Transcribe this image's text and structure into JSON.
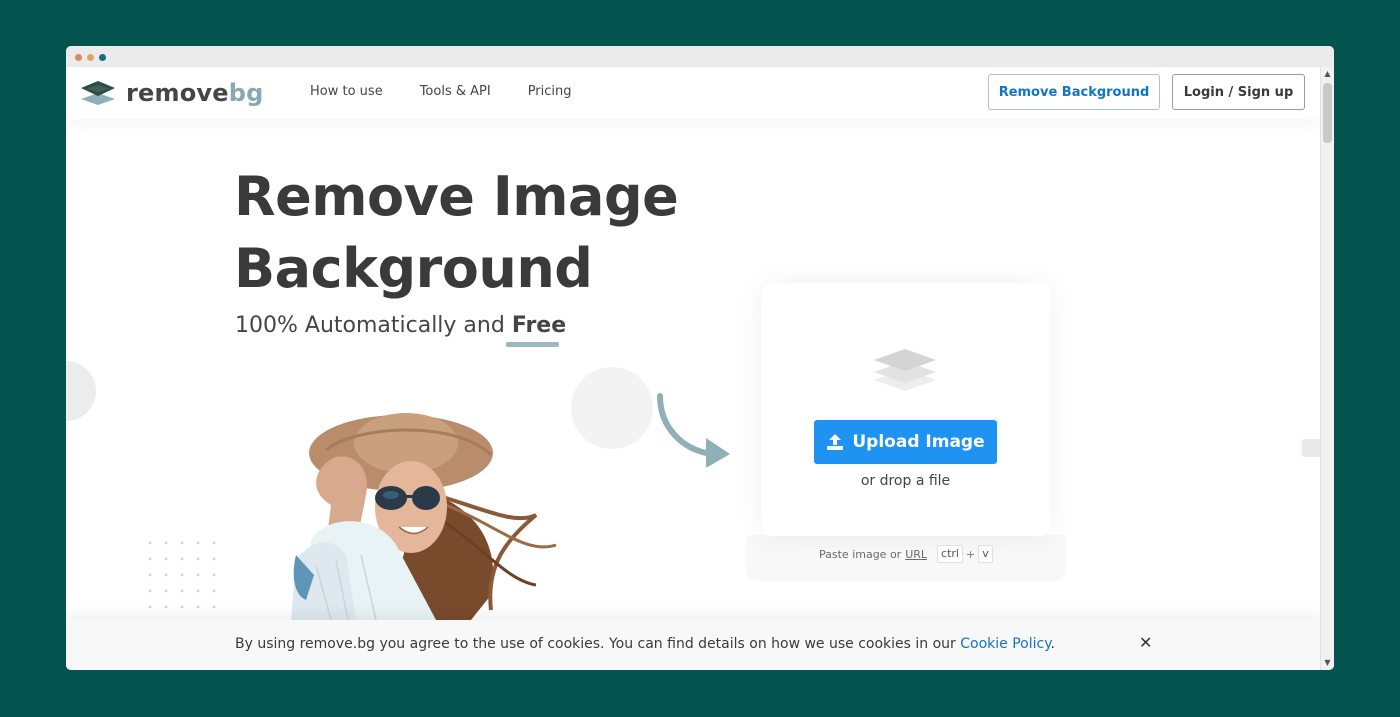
{
  "header": {
    "logo_text_remove": "remove",
    "logo_text_bg": "bg",
    "nav": [
      {
        "label": "How to use"
      },
      {
        "label": "Tools & API"
      },
      {
        "label": "Pricing"
      }
    ],
    "remove_background_button": "Remove Background",
    "login_button": "Login / Sign up"
  },
  "hero": {
    "title_line1": "Remove Image",
    "title_line2": "Background",
    "subtitle_prefix": "100% Automatically and",
    "subtitle_free": "Free"
  },
  "upload": {
    "button_label": "Upload Image",
    "drop_text": "or drop a file",
    "paste_prefix": "Paste image or",
    "paste_url": "URL",
    "shortcut_ctrl": "ctrl",
    "shortcut_plus": "+",
    "shortcut_v": "v"
  },
  "cookie": {
    "text": "By using remove.bg you agree to the use of cookies. You can find details on how we use cookies in our",
    "link": "Cookie Policy",
    "period": ".",
    "close_glyph": "✕"
  },
  "icons": [
    "logo-layers-icon",
    "upload-arrow-icon",
    "layers-icon",
    "close-icon",
    "curved-arrow-icon"
  ],
  "colors": {
    "background": "#03544f",
    "accent_blue": "#1f93f2",
    "link_blue": "#1574c2",
    "logo_bg": "#87a9b2"
  }
}
